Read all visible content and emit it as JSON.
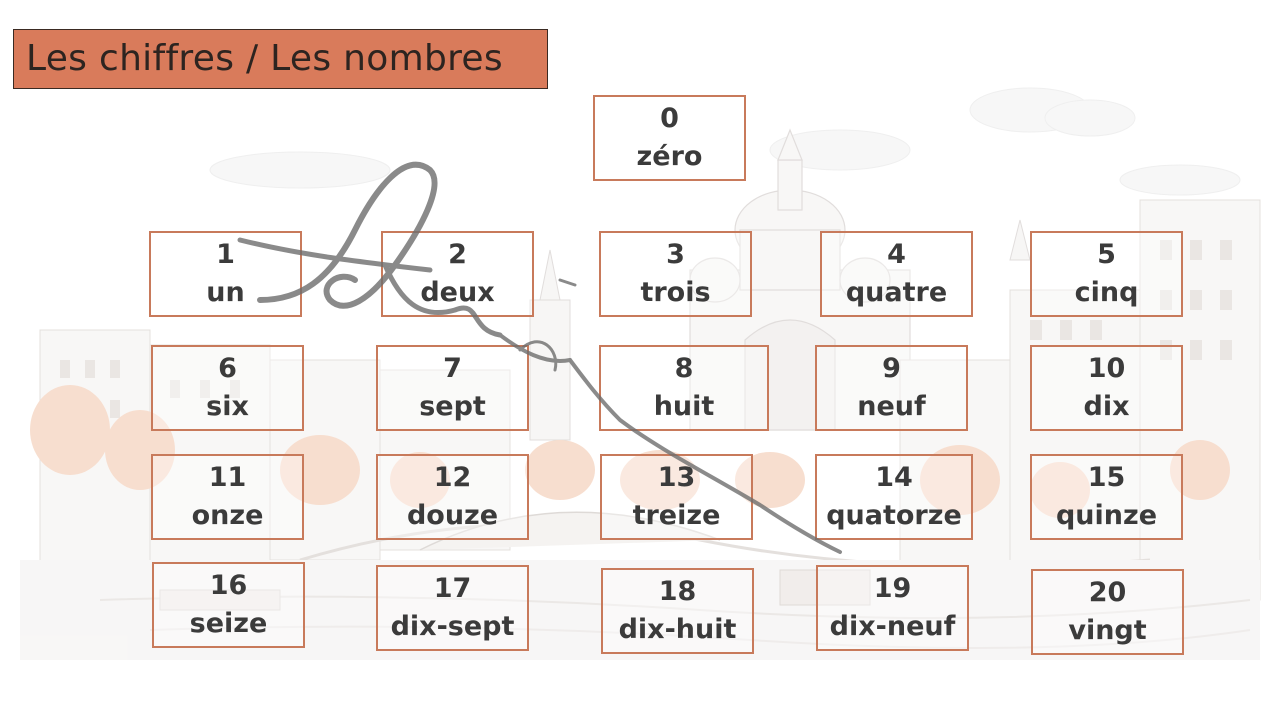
{
  "title": "Les chiffres / Les nombres",
  "numbers": [
    {
      "digit": "0",
      "word": "zéro"
    },
    {
      "digit": "1",
      "word": "un"
    },
    {
      "digit": "2",
      "word": "deux"
    },
    {
      "digit": "3",
      "word": "trois"
    },
    {
      "digit": "4",
      "word": "quatre"
    },
    {
      "digit": "5",
      "word": "cinq"
    },
    {
      "digit": "6",
      "word": "six"
    },
    {
      "digit": "7",
      "word": "sept"
    },
    {
      "digit": "8",
      "word": "huit"
    },
    {
      "digit": "9",
      "word": "neuf"
    },
    {
      "digit": "10",
      "word": "dix"
    },
    {
      "digit": "11",
      "word": "onze"
    },
    {
      "digit": "12",
      "word": "douze"
    },
    {
      "digit": "13",
      "word": "treize"
    },
    {
      "digit": "14",
      "word": "quatorze"
    },
    {
      "digit": "15",
      "word": "quinze"
    },
    {
      "digit": "16",
      "word": "seize"
    },
    {
      "digit": "17",
      "word": "dix-sept"
    },
    {
      "digit": "18",
      "word": "dix-huit"
    },
    {
      "digit": "19",
      "word": "dix-neuf"
    },
    {
      "digit": "20",
      "word": "vingt"
    }
  ],
  "colors": {
    "title_bg": "#d97b5b",
    "card_border": "#c87a5b",
    "text": "#3b3b3b"
  }
}
